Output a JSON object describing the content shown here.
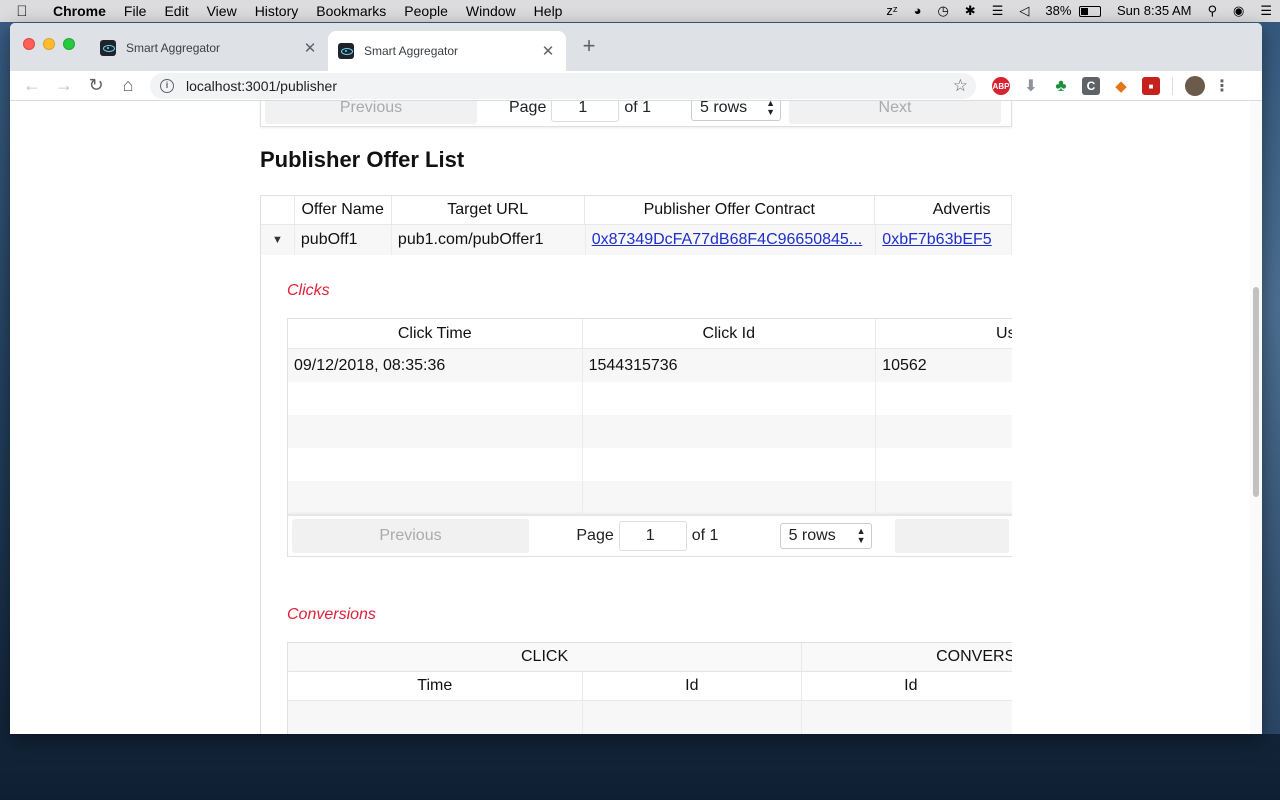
{
  "menubar": {
    "app": "Chrome",
    "items": [
      "File",
      "Edit",
      "View",
      "History",
      "Bookmarks",
      "People",
      "Window",
      "Help"
    ],
    "battery": "38%",
    "clock": "Sun 8:35 AM"
  },
  "browser": {
    "tabs": [
      {
        "title": "Smart Aggregator"
      },
      {
        "title": "Smart Aggregator"
      }
    ],
    "url": "localhost:3001/publisher"
  },
  "top_pagination": {
    "previous": "Previous",
    "page_label": "Page",
    "page_value": "1",
    "of_label": "of 1",
    "rows": "5 rows",
    "next": "Next"
  },
  "section_title": "Publisher Offer List",
  "offer_table": {
    "headers": [
      "Offer Name",
      "Target URL",
      "Publisher Offer Contract",
      "Advertis"
    ],
    "row": {
      "offer_name": "pubOff1",
      "target_url": "pub1.com/pubOffer1",
      "contract": "0x87349DcFA77dB68F4C96650845...",
      "advertiser": "0xbF7b63bEF5"
    }
  },
  "clicks": {
    "label": "Clicks",
    "headers": [
      "Click Time",
      "Click Id",
      "Us"
    ],
    "rows": [
      {
        "time": "09/12/2018, 08:35:36",
        "id": "1544315736",
        "user": "10562"
      }
    ],
    "pagination": {
      "previous": "Previous",
      "page_label": "Page",
      "page_value": "1",
      "of_label": "of 1",
      "rows": "5 rows"
    }
  },
  "conversions": {
    "label": "Conversions",
    "group_headers": [
      "CLICK",
      "CONVERS"
    ],
    "headers": [
      "Time",
      "Id",
      "Id"
    ]
  },
  "colors": {
    "accent_label": "#e0203a",
    "link": "#1f2ecb"
  }
}
